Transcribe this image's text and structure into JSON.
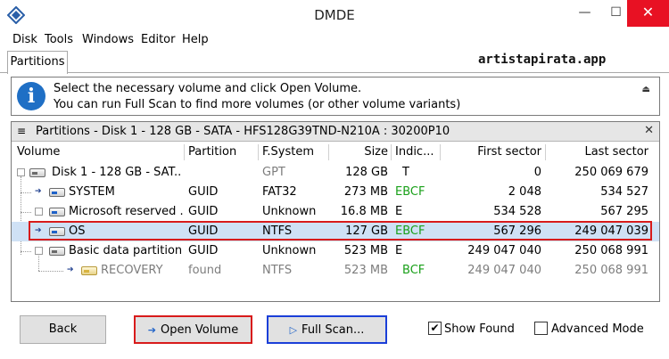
{
  "window": {
    "title": "DMDE",
    "minimize": "—",
    "maximize": "☐",
    "close": "✕"
  },
  "menu": [
    "Disk",
    "Tools",
    "Windows",
    "Editor",
    "Help"
  ],
  "tabs": [
    "Partitions"
  ],
  "watermark": "artistapirata.app",
  "info": {
    "line1": "Select the necessary volume and click Open Volume.",
    "line2": "You can run Full Scan to find more volumes (or other volume variants)",
    "icon": "i",
    "collapse": "⏏"
  },
  "panel": {
    "title": "Partitions - Disk 1 - 128 GB - SATA - HFS128G39TND-N210A : 30200P10",
    "menu_icon": "≡",
    "close": "✕"
  },
  "columns": [
    "Volume",
    "Partition",
    "F.System",
    "Size",
    "Indic...",
    "First sector",
    "Last sector"
  ],
  "rows": [
    {
      "volume": "Disk 1 - 128 GB - SAT...",
      "partition": "",
      "fs": "GPT",
      "size": "128 GB",
      "indic": "T",
      "first": "0",
      "last": "250 069 679"
    },
    {
      "volume": "SYSTEM",
      "partition": "GUID",
      "fs": "FAT32",
      "size": "273 MB",
      "indic": "EBCF",
      "first": "2 048",
      "last": "534 527"
    },
    {
      "volume": "Microsoft reserved ...",
      "partition": "GUID",
      "fs": "Unknown",
      "size": "16.8 MB",
      "indic": "E",
      "first": "534 528",
      "last": "567 295"
    },
    {
      "volume": "OS",
      "partition": "GUID",
      "fs": "NTFS",
      "size": "127 GB",
      "indic": "EBCF",
      "first": "567 296",
      "last": "249 047 039"
    },
    {
      "volume": "Basic data partition",
      "partition": "GUID",
      "fs": "Unknown",
      "size": "523 MB",
      "indic": "E",
      "first": "249 047 040",
      "last": "250 068 991"
    },
    {
      "volume": "RECOVERY",
      "partition": "found",
      "fs": "NTFS",
      "size": "523 MB",
      "indic": "BCF",
      "first": "249 047 040",
      "last": "250 068 991"
    }
  ],
  "buttons": {
    "back": "Back",
    "open_volume": "Open Volume",
    "full_scan": "Full Scan...",
    "open_icon": "➔",
    "scan_icon": "▷"
  },
  "checks": {
    "show_found": {
      "label": "Show Found",
      "mark": "✔"
    },
    "advanced_mode": {
      "label": "Advanced Mode",
      "mark": ""
    }
  },
  "colors": {
    "selection_bg": "#cfe1f5",
    "highlight_red": "#d81b1b",
    "highlight_blue": "#1b3fd8",
    "indicator_green": "#19a019",
    "close_red": "#e81123"
  },
  "selected_row": 3
}
